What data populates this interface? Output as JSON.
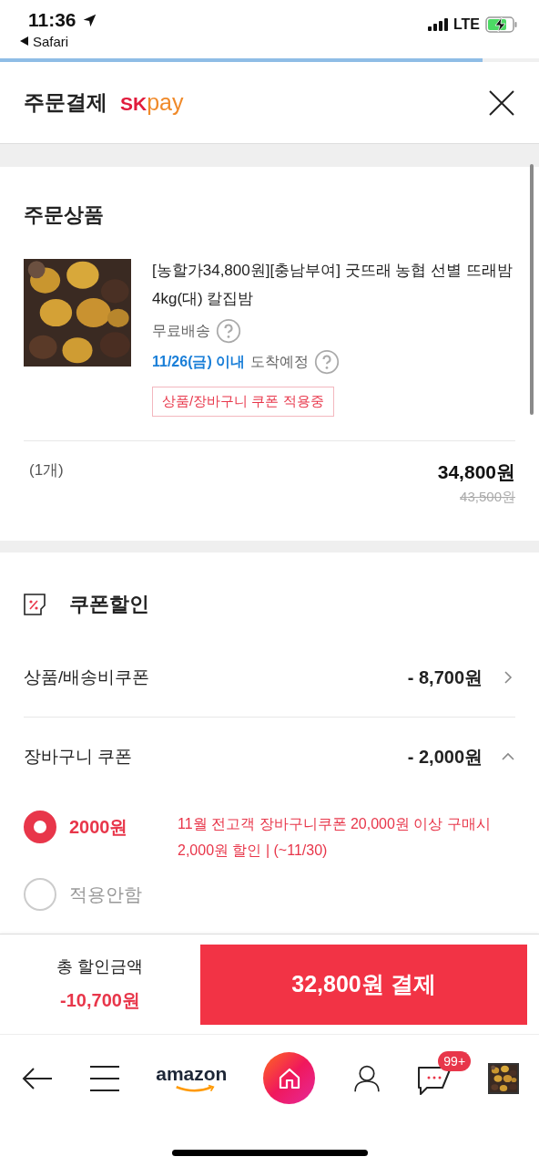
{
  "status_bar": {
    "time": "11:36",
    "back_app": "Safari",
    "network": "LTE"
  },
  "page_progress": {
    "level": 0.895
  },
  "header": {
    "title": "주문결제",
    "logo_left": "SK",
    "logo_right": "pay"
  },
  "order": {
    "title": "주문상품",
    "product": {
      "name": "[농할가34,800원][충남부여] 굿뜨래 농협 선별 뜨래밤 4kg(대) 칼집밤",
      "shipping": "무료배송",
      "arrival_date": "11/26(금) 이내",
      "arrival_text": "도착예정",
      "tag": "상품/장바구니 쿠폰 적용중"
    },
    "quantity": "(1개)",
    "price": "34,800원",
    "original_price": "43,500원"
  },
  "coupon": {
    "title": "쿠폰할인",
    "rows": [
      {
        "label": "상품/배송비쿠폰",
        "amount": "- 8,700원",
        "expanded": false
      },
      {
        "label": "장바구니 쿠폰",
        "amount": "- 2,000원",
        "expanded": true
      }
    ],
    "options": [
      {
        "amount": "2000원",
        "description": "11월 전고객 장바구니쿠폰 20,000원 이상 구매시 2,000원 할인 | (~11/30)",
        "selected": true
      },
      {
        "amount": "적용안함",
        "selected": false
      }
    ]
  },
  "footer": {
    "total_label": "총 할인금액",
    "total": "-10,700원",
    "pay_button": "32,800원 결제"
  },
  "nav": [
    {
      "kind": "back"
    },
    {
      "kind": "menu"
    },
    {
      "kind": "logo",
      "text": "amazon"
    },
    {
      "kind": "home"
    },
    {
      "kind": "profile"
    },
    {
      "kind": "chat",
      "badge": "99+"
    },
    {
      "kind": "recent"
    }
  ]
}
